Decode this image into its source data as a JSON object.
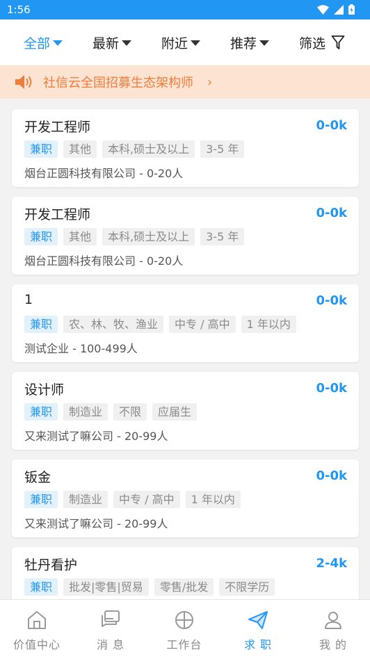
{
  "status_bar": {
    "time": "1:56"
  },
  "filters": [
    {
      "label": "全部",
      "active": true
    },
    {
      "label": "最新",
      "active": false
    },
    {
      "label": "附近",
      "active": false
    },
    {
      "label": "推荐",
      "active": false
    }
  ],
  "filter_screen": {
    "label": "筛选"
  },
  "notice": {
    "text": "社信云全国招募生态架构师",
    "chevron": "›"
  },
  "jobs": [
    {
      "title": "开发工程师",
      "salary": "0-0k",
      "tags": [
        "兼职",
        "其他",
        "本科,硕士及以上",
        "3-5 年"
      ],
      "company": "烟台正圆科技有限公司 - 0-20人"
    },
    {
      "title": "开发工程师",
      "salary": "0-0k",
      "tags": [
        "兼职",
        "其他",
        "本科,硕士及以上",
        "3-5 年"
      ],
      "company": "烟台正圆科技有限公司 - 0-20人"
    },
    {
      "title": "1",
      "salary": "0-0k",
      "tags": [
        "兼职",
        "农、林、牧、渔业",
        "中专 / 高中",
        "1 年以内"
      ],
      "company": "测试企业 - 100-499人"
    },
    {
      "title": "设计师",
      "salary": "0-0k",
      "tags": [
        "兼职",
        "制造业",
        "不限",
        "应届生"
      ],
      "company": "又来测试了嘛公司 - 20-99人"
    },
    {
      "title": "钣金",
      "salary": "0-0k",
      "tags": [
        "兼职",
        "制造业",
        "中专 / 高中",
        "1 年以内"
      ],
      "company": "又来测试了嘛公司 - 20-99人"
    },
    {
      "title": "牡丹看护",
      "salary": "2-4k",
      "tags": [
        "兼职",
        "批发|零售|贸易",
        "零售/批发",
        "不限学历"
      ],
      "company": ""
    }
  ],
  "tabs": [
    {
      "label": "价值中心",
      "icon": "home-icon",
      "active": false
    },
    {
      "label": "消 息",
      "icon": "message-icon",
      "active": false
    },
    {
      "label": "工作台",
      "icon": "workbench-icon",
      "active": false
    },
    {
      "label": "求 职",
      "icon": "send-icon",
      "active": true
    },
    {
      "label": "我 的",
      "icon": "profile-icon",
      "active": false
    }
  ],
  "colors": {
    "primary": "#2196f3",
    "notice_bg": "#fde3d2",
    "notice_text": "#ef7d3c"
  }
}
